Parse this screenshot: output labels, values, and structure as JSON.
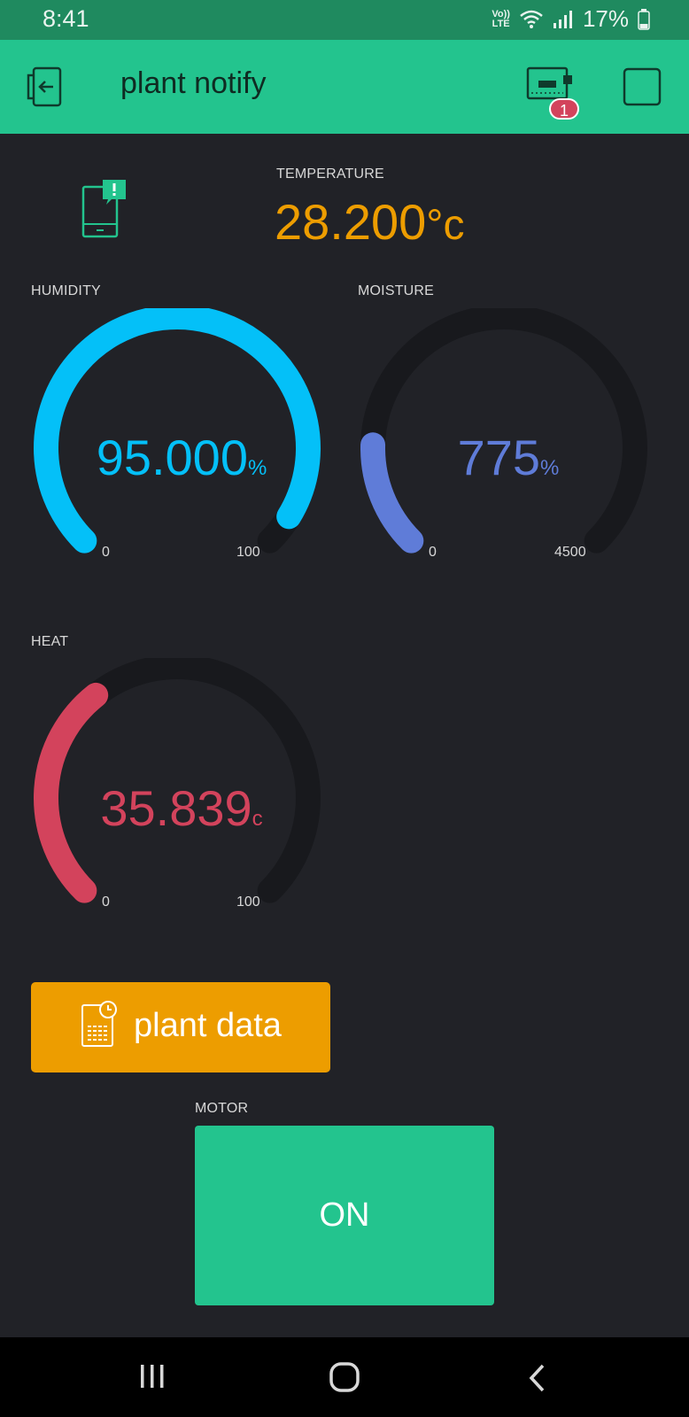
{
  "status": {
    "time": "8:41",
    "battery": "17%",
    "lte_top": "Vo))",
    "lte_bottom": "LTE"
  },
  "app": {
    "title": "plant notify",
    "device_badge": "1"
  },
  "temperature": {
    "label": "TEMPERATURE",
    "value": "28.200",
    "unit": "°c"
  },
  "humidity": {
    "label": "HUMIDITY",
    "value": "95.000",
    "unit": "%",
    "min": "0",
    "max": "100",
    "level": 0.95,
    "color": "#04c0f8"
  },
  "moisture": {
    "label": "MOISTURE",
    "value": "775",
    "unit": "%",
    "min": "0",
    "max": "4500",
    "level": 0.172,
    "color": "#5f7cd8"
  },
  "heat": {
    "label": "HEAT",
    "value": "35.839",
    "unit": "c",
    "min": "0",
    "max": "100",
    "level": 0.358,
    "color": "#d3435c"
  },
  "plant_button": {
    "label": "plant data"
  },
  "motor": {
    "label": "MOTOR",
    "button_label": "ON"
  },
  "colors": {
    "appbar": "#23c48e",
    "background": "#212227",
    "temperature": "#ed9d00",
    "gauge_track": "#18191d"
  },
  "icons": [
    "exit-icon",
    "device-icon",
    "square-icon",
    "notification-phone-icon",
    "report-clock-icon",
    "recents-nav-icon",
    "home-nav-icon",
    "back-nav-icon"
  ]
}
